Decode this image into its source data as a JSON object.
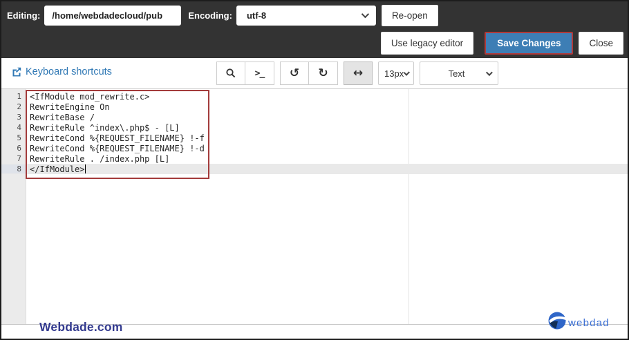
{
  "header": {
    "editing_label": "Editing:",
    "path_value": "/home/webdadecloud/pub",
    "encoding_label": "Encoding:",
    "encoding_value": "utf-8",
    "reopen_button": "Re-open",
    "legacy_button": "Use legacy editor",
    "save_button": "Save Changes",
    "close_button": "Close"
  },
  "toolbar": {
    "shortcuts_link": "Keyboard shortcuts",
    "icons": {
      "search": "magnifier",
      "terminal": ">_",
      "undo": "↺",
      "redo": "↻",
      "wrap": "↔"
    },
    "font_size_value": "13px",
    "syntax_mode_value": "Text"
  },
  "editor": {
    "lines": [
      {
        "num": "1",
        "text": "<IfModule mod_rewrite.c>"
      },
      {
        "num": "2",
        "text": "RewriteEngine On"
      },
      {
        "num": "3",
        "text": "RewriteBase /"
      },
      {
        "num": "4",
        "text": "RewriteRule ^index\\.php$ - [L]"
      },
      {
        "num": "5",
        "text": "RewriteCond %{REQUEST_FILENAME} !-f"
      },
      {
        "num": "6",
        "text": "RewriteCond %{REQUEST_FILENAME} !-d"
      },
      {
        "num": "7",
        "text": "RewriteRule . /index.php [L]"
      },
      {
        "num": "8",
        "text": "</IfModule>"
      }
    ]
  },
  "footer": {
    "watermark_text": "Webdade.com",
    "logo_text": "webdade"
  },
  "colors": {
    "header_bg": "#333333",
    "save_button_bg": "#3d7eb5",
    "annotation_red": "#a33b3b",
    "link_blue": "#3179b5",
    "watermark_blue": "#333a8f",
    "logo_blue": "#3b6fd4"
  }
}
